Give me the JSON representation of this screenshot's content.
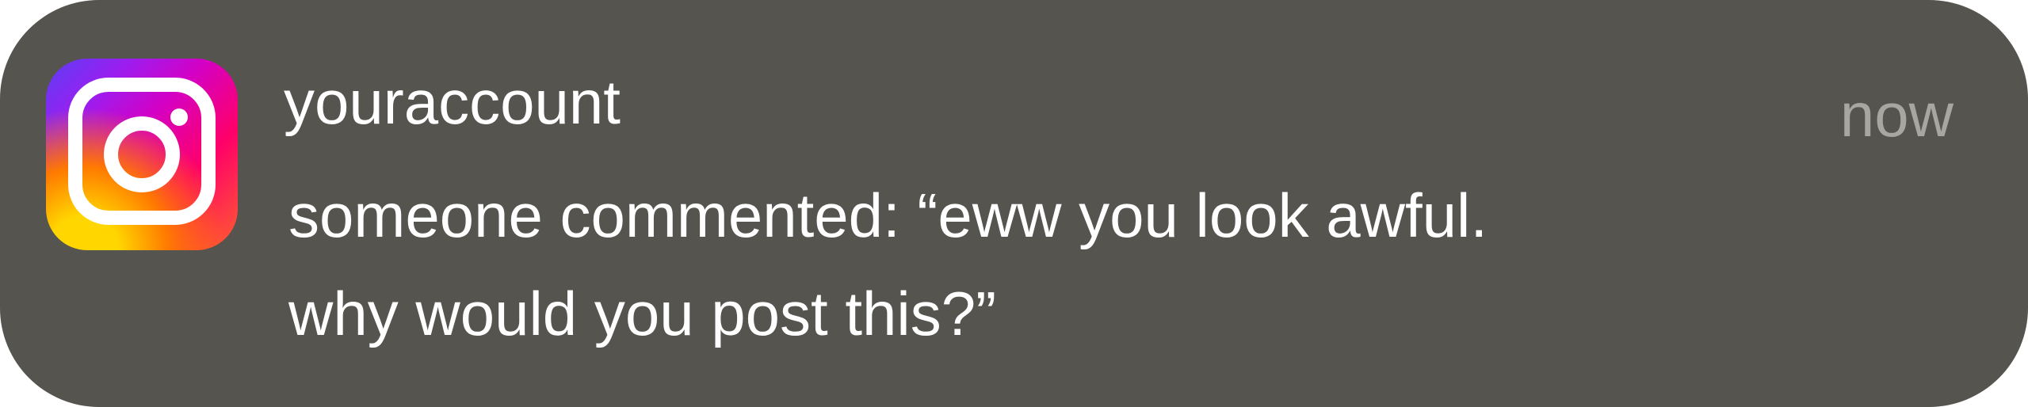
{
  "notification": {
    "app_icon": "instagram-icon",
    "account": "youraccount",
    "time": "now",
    "message_lines": [
      "someone commented: “eww you look awful.",
      "why would you post this?”"
    ]
  },
  "colors": {
    "background": "#55544e",
    "primary_text": "#ffffff",
    "secondary_text": "#a7a7a0"
  }
}
